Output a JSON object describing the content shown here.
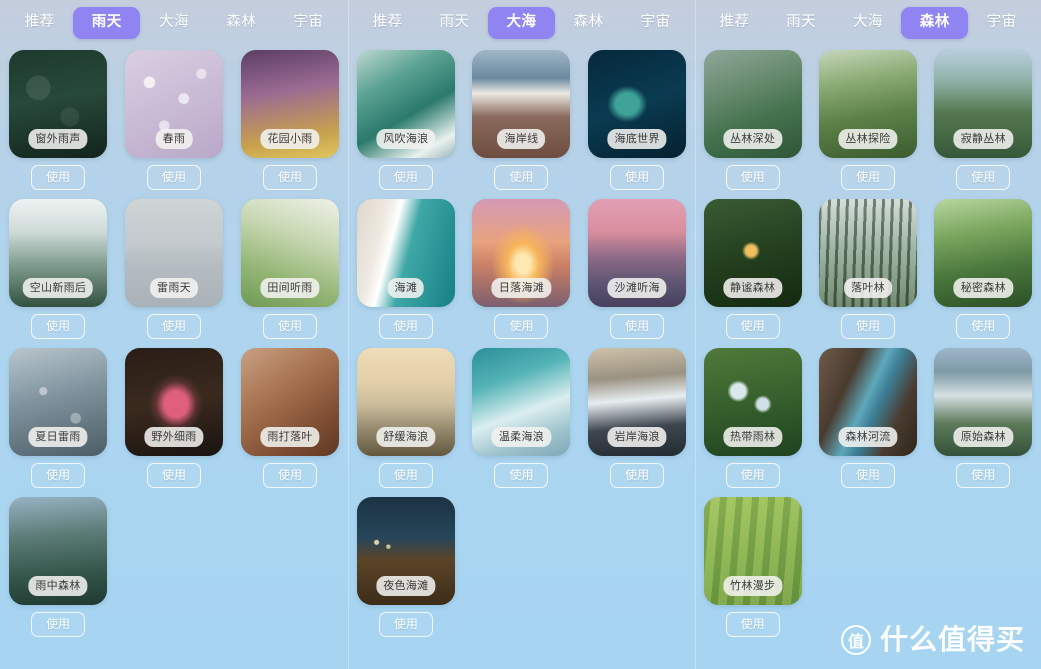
{
  "watermark": {
    "badge": "值",
    "text": "什么值得买"
  },
  "panels": [
    {
      "id": "rain",
      "tabs": [
        {
          "label": "推荐",
          "active": false
        },
        {
          "label": "雨天",
          "active": true
        },
        {
          "label": "大海",
          "active": false
        },
        {
          "label": "森林",
          "active": false
        },
        {
          "label": "宇宙",
          "active": false
        }
      ],
      "use_label": "使用",
      "cards": [
        {
          "title": "窗外雨声",
          "art": "art-rain-window"
        },
        {
          "title": "春雨",
          "art": "art-spring-rain"
        },
        {
          "title": "花园小雨",
          "art": "art-garden-rain"
        },
        {
          "title": "空山新雨后",
          "art": "art-empty-mtn"
        },
        {
          "title": "雷雨天",
          "art": "art-thunder-day"
        },
        {
          "title": "田间听雨",
          "art": "art-field-rain"
        },
        {
          "title": "夏日雷雨",
          "art": "art-summer-storm"
        },
        {
          "title": "野外细雨",
          "art": "art-wild-drizzle"
        },
        {
          "title": "雨打落叶",
          "art": "art-fallen-leaves"
        },
        {
          "title": "雨中森林",
          "art": "art-rain-forest"
        }
      ]
    },
    {
      "id": "sea",
      "tabs": [
        {
          "label": "推荐",
          "active": false
        },
        {
          "label": "雨天",
          "active": false
        },
        {
          "label": "大海",
          "active": true
        },
        {
          "label": "森林",
          "active": false
        },
        {
          "label": "宇宙",
          "active": false
        }
      ],
      "use_label": "使用",
      "cards": [
        {
          "title": "风吹海浪",
          "art": "art-wind-waves"
        },
        {
          "title": "海岸线",
          "art": "art-coastline"
        },
        {
          "title": "海底世界",
          "art": "art-undersea"
        },
        {
          "title": "海滩",
          "art": "art-beach"
        },
        {
          "title": "日落海滩",
          "art": "art-sunset-beach"
        },
        {
          "title": "沙滩听海",
          "art": "art-sand-listen"
        },
        {
          "title": "舒缓海浪",
          "art": "art-gentle-waves"
        },
        {
          "title": "温柔海浪",
          "art": "art-soft-sea"
        },
        {
          "title": "岩岸海浪",
          "art": "art-rocky-shore"
        },
        {
          "title": "夜色海滩",
          "art": "art-night-beach"
        }
      ]
    },
    {
      "id": "forest",
      "tabs": [
        {
          "label": "推荐",
          "active": false
        },
        {
          "label": "雨天",
          "active": false
        },
        {
          "label": "大海",
          "active": false
        },
        {
          "label": "森林",
          "active": true
        },
        {
          "label": "宇宙",
          "active": false
        }
      ],
      "use_label": "使用",
      "cards": [
        {
          "title": "丛林深处",
          "art": "art-deep-jungle"
        },
        {
          "title": "丛林探险",
          "art": "art-jungle-adv"
        },
        {
          "title": "寂静丛林",
          "art": "art-quiet-wood"
        },
        {
          "title": "静谧森林",
          "art": "art-silent-forest"
        },
        {
          "title": "落叶林",
          "art": "art-leaf-wood"
        },
        {
          "title": "秘密森林",
          "art": "art-secret-forest"
        },
        {
          "title": "热带雨林",
          "art": "art-tropical"
        },
        {
          "title": "森林河流",
          "art": "art-forest-river"
        },
        {
          "title": "原始森林",
          "art": "art-primeval"
        },
        {
          "title": "竹林漫步",
          "art": "art-bamboo"
        }
      ]
    }
  ],
  "theme": {
    "active_tab_bg": "#9084f2",
    "label_bg": "#f2f2f0",
    "bg_top": "#c5cddd",
    "bg_bottom": "#a6d4f1"
  }
}
